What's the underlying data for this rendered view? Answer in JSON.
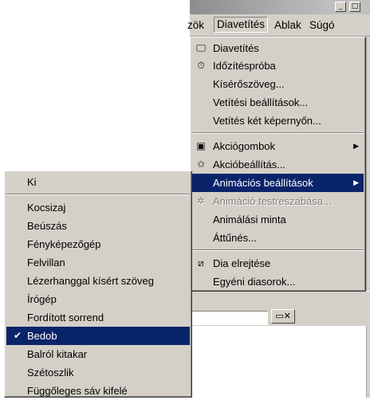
{
  "titlebar": {
    "buttons": [
      "_",
      "□"
    ]
  },
  "menubar": {
    "items": [
      {
        "label": "zök",
        "key": "partial"
      },
      {
        "label": "Diavetítés",
        "key": "active"
      },
      {
        "label": "Ablak"
      },
      {
        "label": "Súgó"
      }
    ]
  },
  "main_menu": {
    "items": [
      {
        "label": "Diavetítés",
        "icon": "screen-icon"
      },
      {
        "label": "Időzítéspróba",
        "icon": "clock-icon"
      },
      {
        "label": "Kísérőszöveg..."
      },
      {
        "label": "Vetítési beállítások..."
      },
      {
        "label": "Vetítés két képernyőn..."
      },
      {
        "label": "Akciógombok",
        "icon": "action-buttons-icon",
        "submenu": true
      },
      {
        "label": "Akcióbeállítás...",
        "icon": "star-hand-icon"
      },
      {
        "label": "Animációs beállítások",
        "submenu": true,
        "selected": true
      },
      {
        "label": "Animáció testreszabása...",
        "icon": "custom-animation-icon",
        "disabled": true
      },
      {
        "label": "Animálási minta"
      },
      {
        "label": "Áttűnés..."
      },
      {
        "label": "Dia elrejtése",
        "icon": "hide-slide-icon"
      },
      {
        "label": "Egyéni diasorok..."
      }
    ]
  },
  "sub_menu": {
    "items": [
      {
        "label": "Ki"
      },
      {
        "label": "Kocsizaj"
      },
      {
        "label": "Beúszás"
      },
      {
        "label": "Fényképezőgép"
      },
      {
        "label": "Felvillan"
      },
      {
        "label": "Lézerhanggal kísért szöveg"
      },
      {
        "label": "Írógép"
      },
      {
        "label": "Fordított sorrend"
      },
      {
        "label": "Bedob",
        "checked": true,
        "selected": true
      },
      {
        "label": "Balról kitakar"
      },
      {
        "label": "Szétoszlik"
      },
      {
        "label": "Függőleges sáv kifelé"
      }
    ]
  },
  "colors": {
    "menu_bg": "#d4d0c8",
    "highlight": "#0a246a",
    "disabled": "#808080"
  }
}
